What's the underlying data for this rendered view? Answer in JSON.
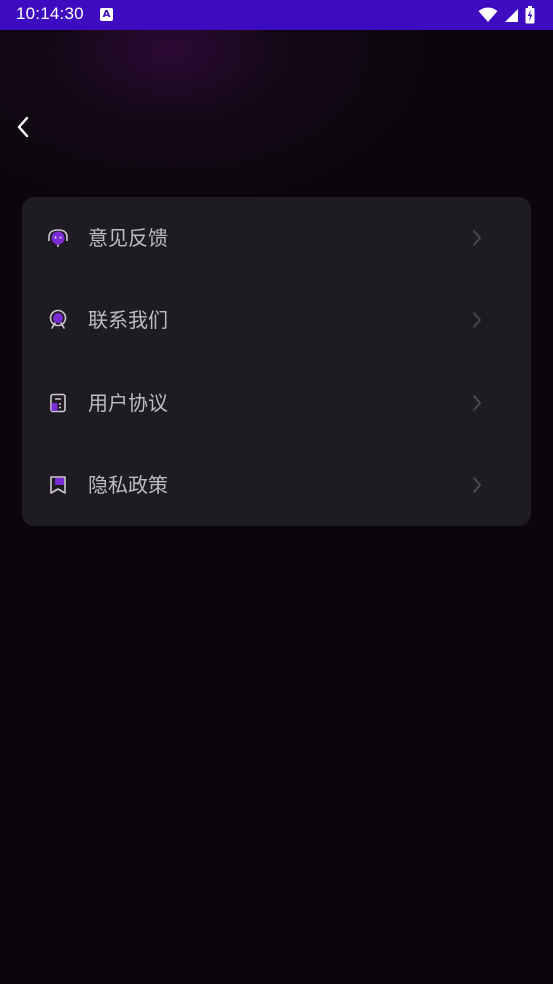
{
  "status_bar": {
    "time": "10:14:30",
    "notification_badge": "A"
  },
  "colors": {
    "status_bar_bg": "#3d0bc0",
    "accent_purple": "#7b2bd6",
    "card_bg": "#1e1b21",
    "text_secondary": "#bfbbc4"
  },
  "menu": {
    "items": [
      {
        "label": "意见反馈",
        "icon": "feedback-chat-icon"
      },
      {
        "label": "联系我们",
        "icon": "customer-service-icon"
      },
      {
        "label": "用户协议",
        "icon": "document-icon"
      },
      {
        "label": "隐私政策",
        "icon": "bookmark-policy-icon"
      }
    ]
  }
}
